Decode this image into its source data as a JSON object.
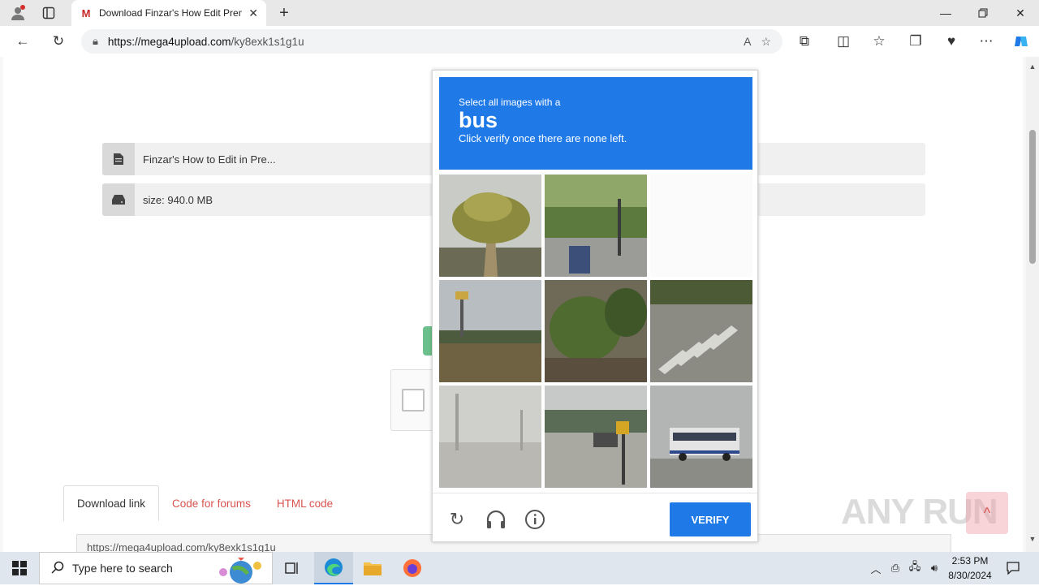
{
  "browser": {
    "tab_title": "Download Finzar's How Edit Prem",
    "favicon": "M",
    "url_host": "https://mega4upload.com",
    "url_path": "/ky8exk1s1g1u"
  },
  "page": {
    "file_name": "Finzar's How to Edit in Pre...",
    "file_size": "size: 940.0 MB",
    "tabs": [
      "Download link",
      "Code for forums",
      "HTML code"
    ],
    "link_value": "https://mega4upload.com/ky8exk1s1g1u"
  },
  "captcha": {
    "line1": "Select all images with a",
    "target": "bus",
    "line3": "Click verify once there are none left.",
    "verify_label": "VERIFY"
  },
  "watermark": "ANY RUN",
  "taskbar": {
    "search_placeholder": "Type here to search",
    "time": "2:53 PM",
    "date": "8/30/2024"
  }
}
